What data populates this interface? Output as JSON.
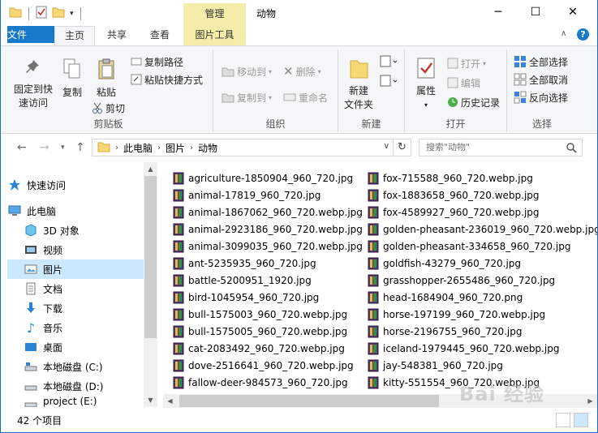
{
  "window": {
    "title": "动物",
    "context_tab_header": "管理"
  },
  "ribbon_tabs": [
    "文件",
    "主页",
    "共享",
    "查看",
    "图片工具"
  ],
  "ribbon": {
    "clipboard": {
      "label": "剪贴板",
      "pin": "固定到快\n速访问",
      "copy": "复制",
      "paste": "粘贴",
      "copy_path": "复制路径",
      "paste_shortcut": "粘贴快捷方式",
      "cut": "剪切"
    },
    "organize": {
      "label": "组织",
      "move_to": "移动到",
      "delete": "删除",
      "copy_to": "复制到",
      "rename": "重命名"
    },
    "new": {
      "label": "新建",
      "new_folder": "新建\n文件夹"
    },
    "open": {
      "label": "打开",
      "properties": "属性",
      "open": "打开",
      "edit": "编辑",
      "history": "历史记录"
    },
    "select": {
      "label": "选择",
      "select_all": "全部选择",
      "select_none": "全部取消",
      "invert": "反向选择"
    }
  },
  "address": {
    "crumbs": [
      "此电脑",
      "图片",
      "动物"
    ],
    "search_placeholder": "搜索\"动物\""
  },
  "nav_pane": [
    {
      "label": "快速访问",
      "icon": "star-icon"
    },
    {
      "label": "此电脑",
      "icon": "computer-icon"
    },
    {
      "label": "3D 对象",
      "icon": "cube-icon"
    },
    {
      "label": "视频",
      "icon": "video-icon"
    },
    {
      "label": "图片",
      "icon": "pictures-icon",
      "selected": true
    },
    {
      "label": "文档",
      "icon": "document-icon"
    },
    {
      "label": "下载",
      "icon": "download-icon"
    },
    {
      "label": "音乐",
      "icon": "music-icon"
    },
    {
      "label": "桌面",
      "icon": "desktop-icon"
    },
    {
      "label": "本地磁盘 (C:)",
      "icon": "drive-icon"
    },
    {
      "label": "本地磁盘 (D:)",
      "icon": "drive-icon"
    },
    {
      "label": "project (E:)",
      "icon": "drive-icon"
    }
  ],
  "files_col1": [
    "agriculture-1850904_960_720.jpg",
    "animal-17819_960_720.jpg",
    "animal-1867062_960_720.webp.jpg",
    "animal-2923186_960_720.webp.jpg",
    "animal-3099035_960_720.webp.jpg",
    "ant-5235935_960_720.jpg",
    "battle-5200951_1920.jpg",
    "bird-1045954_960_720.jpg",
    "bull-1575003_960_720.webp.jpg",
    "bull-1575005_960_720.webp.jpg",
    "cat-2083492_960_720.webp.jpg",
    "dove-2516641_960_720.webp.jpg",
    "fallow-deer-984573_960_720.jpg"
  ],
  "files_col2": [
    "fox-715588_960_720.webp.jpg",
    "fox-1883658_960_720.webp.jpg",
    "fox-4589927_960_720.webp.jpg",
    "golden-pheasant-236019_960_720.webp.jpg",
    "golden-pheasant-334658_960_720.jpg",
    "goldfish-43279_960_720.jpg",
    "grasshopper-2655486_960_720.jpg",
    "head-1684904_960_720.png",
    "horse-197199_960_720.webp.jpg",
    "horse-2196755_960_720.jpg",
    "iceland-1979445_960_720.webp.jpg",
    "jay-548381_960_720.jpg",
    "kitty-551554_960_720.webp.jpg"
  ],
  "status": {
    "count": "42 个项目"
  },
  "watermark": "Bai 经验"
}
